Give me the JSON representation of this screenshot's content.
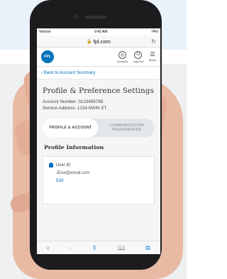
{
  "status": {
    "carrier": "Verizon",
    "time": "9:42 AM",
    "battery": "74%"
  },
  "browser": {
    "url": "fpl.com"
  },
  "app": {
    "logo_text": "FPL",
    "nav": [
      {
        "label": "Account",
        "icon": "account-icon"
      },
      {
        "label": "Log Out",
        "icon": "logout-icon"
      },
      {
        "label": "Menu",
        "icon": "menu-icon"
      }
    ]
  },
  "page": {
    "back_link": "Back to Account Summary",
    "title": "Profile & Preference Settings",
    "account_number": "Account Number: 0123456789",
    "service_address": "Service Address: 1234 MAIN ST",
    "tabs": [
      {
        "label": "PROFILE & ACCOUNT"
      },
      {
        "label": "COMMUNICATION PREFERENCES"
      }
    ],
    "section_title": "Profile Information",
    "user_id_label": "User ID",
    "email": "JDoe@email.com",
    "edit": "Edit"
  },
  "toolbar": {
    "back": "‹",
    "forward": "›",
    "share": "⇪",
    "bookmarks": "📖",
    "tabs": "⧉"
  }
}
